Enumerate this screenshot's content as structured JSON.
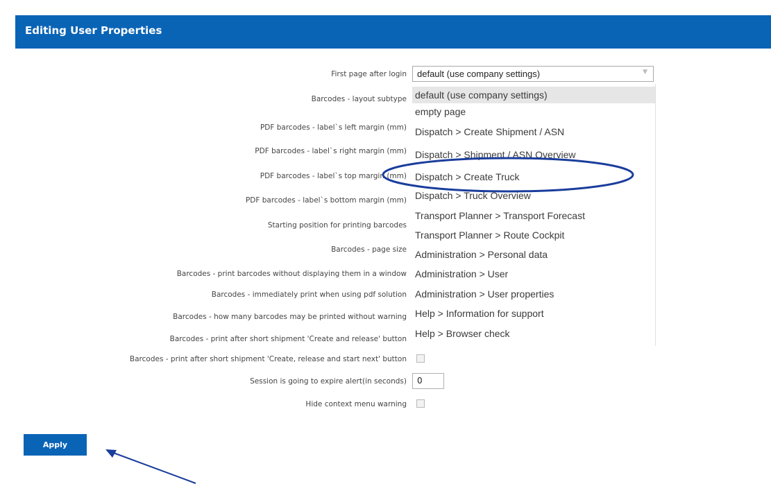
{
  "header": {
    "title": "Editing User Properties"
  },
  "labels": {
    "first_page": "First page after login",
    "layout_subtype": "Barcodes - layout subtype",
    "left_margin": "PDF barcodes - label`s left margin (mm)",
    "right_margin": "PDF barcodes - label`s right margin (mm)",
    "top_margin": "PDF barcodes - label`s top margin (mm)",
    "bottom_margin": "PDF barcodes - label`s bottom margin (mm)",
    "starting_position": "Starting position for printing barcodes",
    "page_size": "Barcodes - page size",
    "print_no_window": "Barcodes - print barcodes without displaying them in a window",
    "immediately_print": "Barcodes - immediately print when using pdf solution",
    "how_many": "Barcodes - how many barcodes may be printed without warning",
    "print_after_release": "Barcodes - print after short shipment 'Create and release' button",
    "print_after_release_next": "Barcodes - print after short shipment 'Create, release and start next' button",
    "session_expire": "Session is going to expire alert(in seconds)",
    "hide_context_menu": "Hide context menu warning"
  },
  "first_page_select": {
    "value": "default (use company settings)",
    "options": [
      "default (use company settings)",
      "empty page",
      "Dispatch > Create Shipment / ASN",
      "Dispatch > Shipment / ASN Overview",
      "Dispatch > Create Truck",
      "Dispatch > Truck Overview",
      "Transport Planner > Transport Forecast",
      "Transport Planner > Route Cockpit",
      "Administration > Personal data",
      "Administration > User",
      "Administration > User properties",
      "Help > Information for support",
      "Help > Browser check"
    ]
  },
  "session_expire_value": "0",
  "apply_label": "Apply",
  "colors": {
    "header": "#0a64b6",
    "annotation": "#1a3d9c"
  }
}
